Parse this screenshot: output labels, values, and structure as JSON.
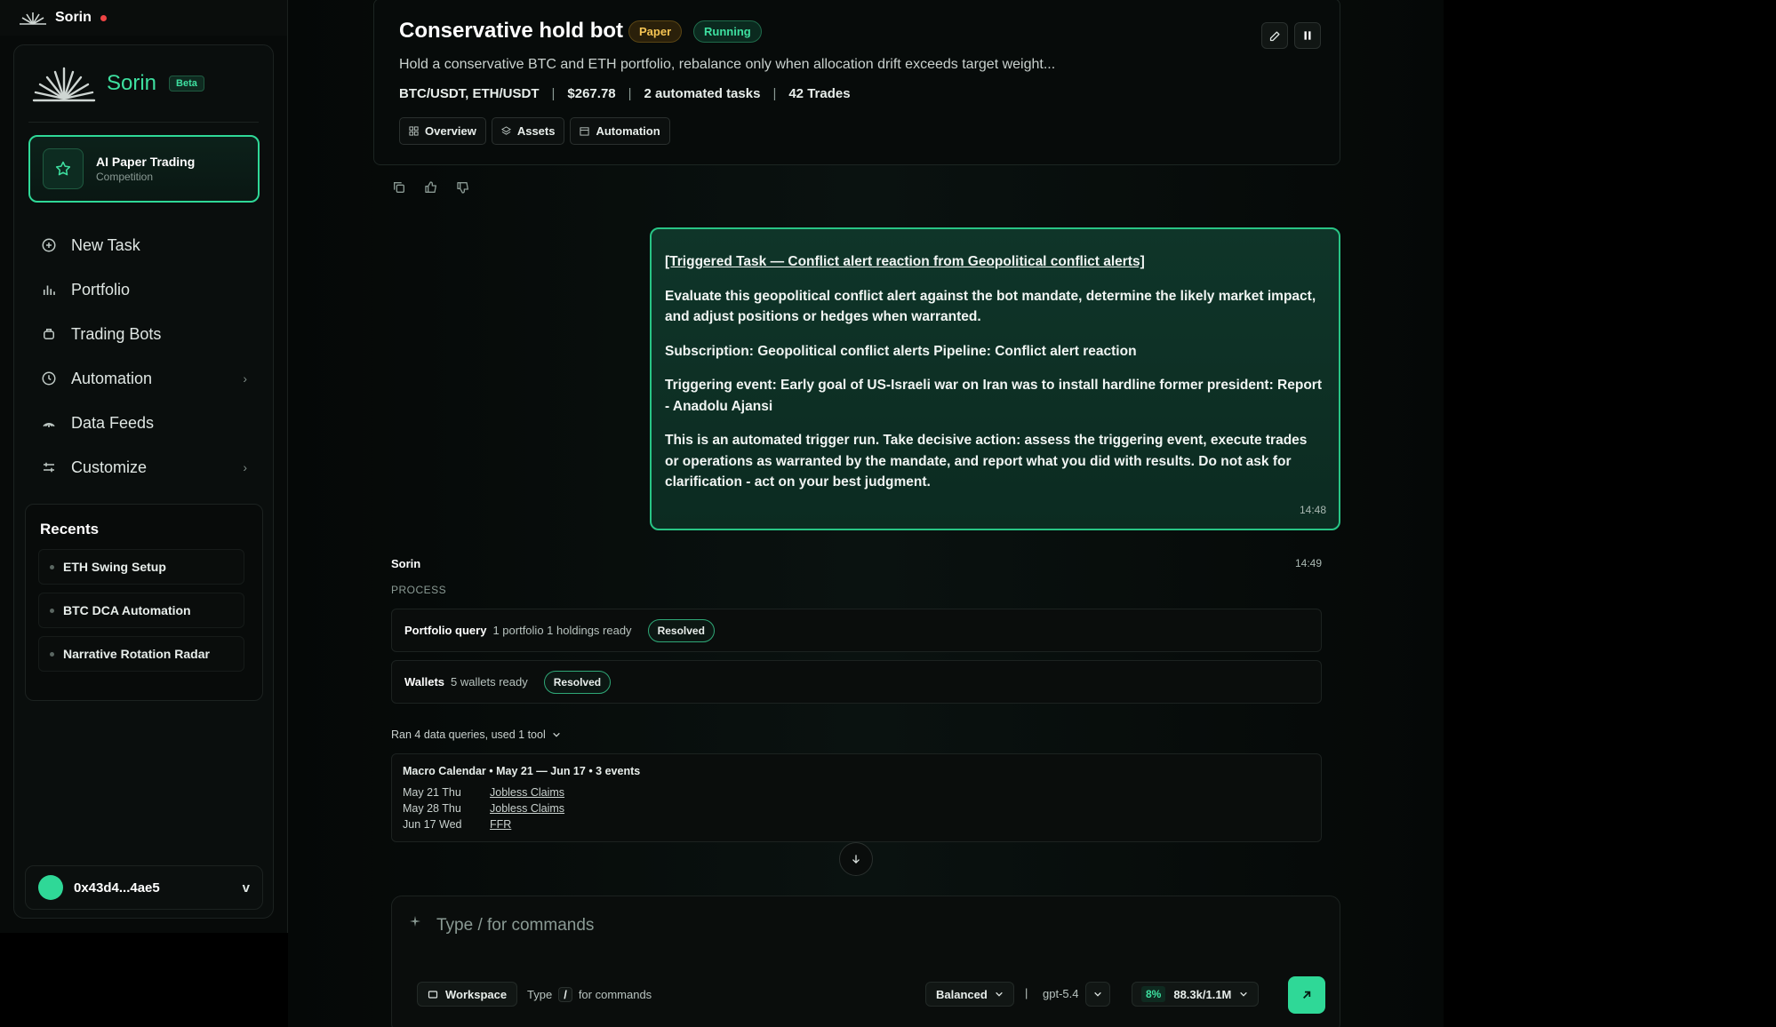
{
  "app": {
    "name": "Sorin"
  },
  "sidebar": {
    "brand": "Sorin",
    "beta": "Beta",
    "competition": {
      "title": "AI Paper Trading",
      "subtitle": "Competition"
    },
    "nav": [
      {
        "label": "New Task",
        "icon": "plus-circle-icon"
      },
      {
        "label": "Portfolio",
        "icon": "bar-chart-icon"
      },
      {
        "label": "Trading Bots",
        "icon": "bot-icon"
      },
      {
        "label": "Automation",
        "icon": "clock-icon",
        "chevron": "›"
      },
      {
        "label": "Data Feeds",
        "icon": "feed-icon"
      },
      {
        "label": "Customize",
        "icon": "sliders-icon",
        "chevron": "›"
      }
    ],
    "recents_title": "Recents",
    "recents": [
      "ETH Swing Setup",
      "BTC DCA Automation",
      "Narrative Rotation Radar"
    ],
    "wallet": {
      "address": "0x43d4...4ae5",
      "chevron": "v"
    }
  },
  "header": {
    "title": "Conservative hold bot",
    "badge_paper": "Paper",
    "badge_running": "Running",
    "description": "Hold a conservative BTC and ETH portfolio, rebalance only when allocation drift exceeds target weight...",
    "meta": {
      "pairs": "BTC/USDT, ETH/USDT",
      "sep": "|",
      "value": "$267.78",
      "tasks": "2 automated tasks",
      "trades": "42 Trades"
    },
    "tabs": [
      "Overview",
      "Assets",
      "Automation"
    ]
  },
  "message": {
    "trigger": "[Triggered Task — Conflict alert reaction from Geopolitical conflict alerts]",
    "p1": "Evaluate this geopolitical conflict alert against the bot mandate, determine the likely market impact, and adjust positions or hedges when warranted.",
    "p2": "Subscription: Geopolitical conflict alerts Pipeline: Conflict alert reaction",
    "p3": "Triggering event: Early goal of US-Israeli war on Iran was to install hardline former president: Report - Anadolu Ajansi",
    "p4": "This is an automated trigger run. Take decisive action: assess the triggering event, execute trades or operations as warranted by the mandate, and report what you did with results. Do not ask for clarification - act on your best judgment.",
    "time": "14:48"
  },
  "assistant": {
    "name": "Sorin",
    "time": "14:49",
    "process_label": "PROCESS",
    "steps": [
      {
        "title": "Portfolio query",
        "detail": "1 portfolio 1 holdings ready",
        "status": "Resolved"
      },
      {
        "title": "Wallets",
        "detail": "5 wallets ready",
        "status": "Resolved"
      }
    ],
    "ran_summary": "Ran 4 data queries, used 1 tool",
    "macro": {
      "title": "Macro Calendar • May 21 — Jun 17 • 3 events",
      "events": [
        {
          "date": "May 21 Thu",
          "name": "Jobless Claims"
        },
        {
          "date": "May 28 Thu",
          "name": "Jobless Claims"
        },
        {
          "date": "Jun 17 Wed",
          "name": "FFR"
        }
      ]
    }
  },
  "composer": {
    "placeholder": "Type / for commands",
    "workspace": "Workspace",
    "hint_pre": "Type",
    "hint_key": "/",
    "hint_post": "for commands",
    "mode": "Balanced",
    "pipe": "|",
    "model": "gpt-5.4",
    "usage_pct": "8%",
    "usage_tokens": "88.3k/1.1M"
  },
  "colors": {
    "accent": "#2fd897",
    "paper": "#f5c453",
    "background": "#000000"
  }
}
